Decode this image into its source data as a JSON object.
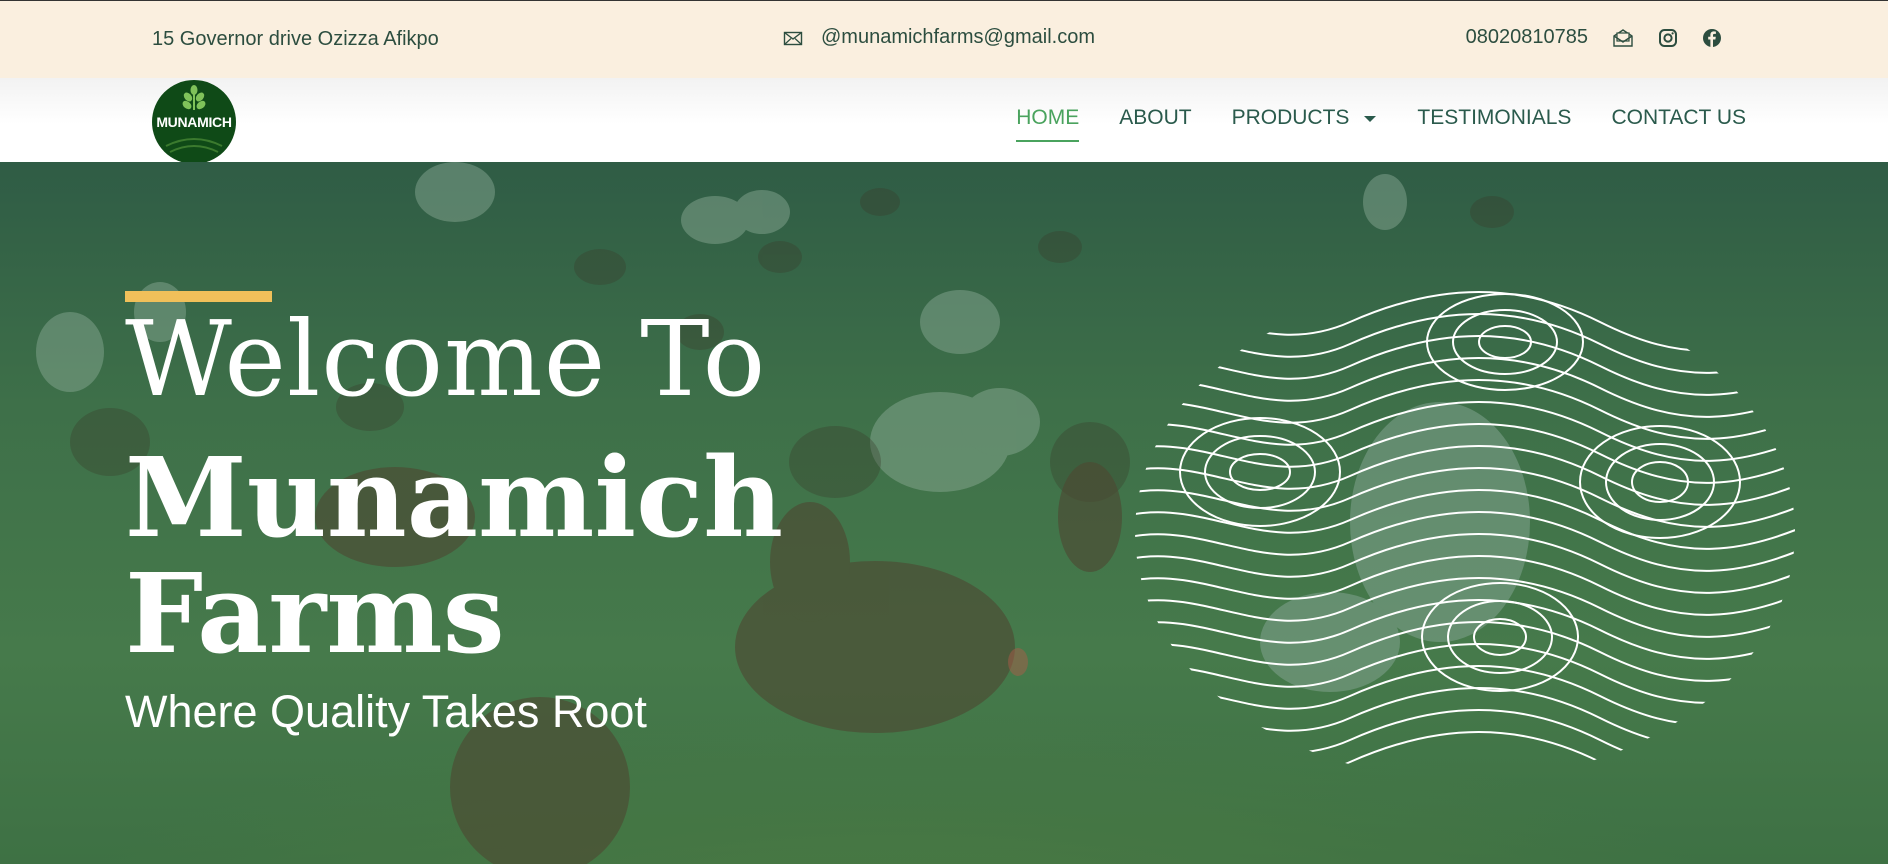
{
  "topbar": {
    "address": "15 Governor drive Ozizza Afikpo",
    "email": "@munamichfarms@gmail.com",
    "phone": "08020810785",
    "icons": [
      "envelope-icon",
      "mail-open-icon",
      "instagram-icon",
      "facebook-icon"
    ]
  },
  "logo": {
    "text": "MUNAMICH"
  },
  "nav": {
    "items": [
      {
        "label": "HOME",
        "active": true
      },
      {
        "label": "ABOUT",
        "active": false
      },
      {
        "label": "PRODUCTS",
        "active": false,
        "has_dropdown": true
      },
      {
        "label": "TESTIMONIALS",
        "active": false
      },
      {
        "label": "CONTACT US",
        "active": false
      }
    ]
  },
  "hero": {
    "welcome": "Welcome To",
    "brand_line1": "Munamich",
    "brand_line2": "Farms",
    "tagline": "Where Quality Takes Root"
  },
  "colors": {
    "topbar_bg": "#faefdf",
    "accent": "#f0c05a",
    "nav_active": "#4aa35e",
    "hero_overlay": "#2f6a45",
    "logo_bg": "#0f4a17"
  }
}
